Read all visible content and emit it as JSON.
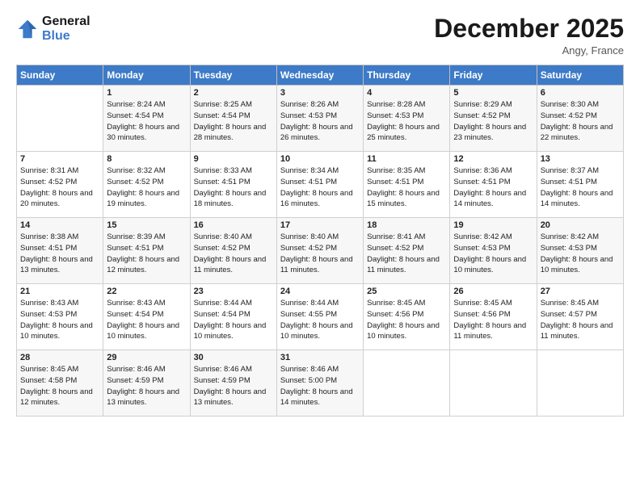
{
  "header": {
    "logo_line1": "General",
    "logo_line2": "Blue",
    "month": "December 2025",
    "location": "Angy, France"
  },
  "days_of_week": [
    "Sunday",
    "Monday",
    "Tuesday",
    "Wednesday",
    "Thursday",
    "Friday",
    "Saturday"
  ],
  "weeks": [
    [
      {
        "day": "",
        "sunrise": "",
        "sunset": "",
        "daylight": ""
      },
      {
        "day": "1",
        "sunrise": "Sunrise: 8:24 AM",
        "sunset": "Sunset: 4:54 PM",
        "daylight": "Daylight: 8 hours and 30 minutes."
      },
      {
        "day": "2",
        "sunrise": "Sunrise: 8:25 AM",
        "sunset": "Sunset: 4:54 PM",
        "daylight": "Daylight: 8 hours and 28 minutes."
      },
      {
        "day": "3",
        "sunrise": "Sunrise: 8:26 AM",
        "sunset": "Sunset: 4:53 PM",
        "daylight": "Daylight: 8 hours and 26 minutes."
      },
      {
        "day": "4",
        "sunrise": "Sunrise: 8:28 AM",
        "sunset": "Sunset: 4:53 PM",
        "daylight": "Daylight: 8 hours and 25 minutes."
      },
      {
        "day": "5",
        "sunrise": "Sunrise: 8:29 AM",
        "sunset": "Sunset: 4:52 PM",
        "daylight": "Daylight: 8 hours and 23 minutes."
      },
      {
        "day": "6",
        "sunrise": "Sunrise: 8:30 AM",
        "sunset": "Sunset: 4:52 PM",
        "daylight": "Daylight: 8 hours and 22 minutes."
      }
    ],
    [
      {
        "day": "7",
        "sunrise": "Sunrise: 8:31 AM",
        "sunset": "Sunset: 4:52 PM",
        "daylight": "Daylight: 8 hours and 20 minutes."
      },
      {
        "day": "8",
        "sunrise": "Sunrise: 8:32 AM",
        "sunset": "Sunset: 4:52 PM",
        "daylight": "Daylight: 8 hours and 19 minutes."
      },
      {
        "day": "9",
        "sunrise": "Sunrise: 8:33 AM",
        "sunset": "Sunset: 4:51 PM",
        "daylight": "Daylight: 8 hours and 18 minutes."
      },
      {
        "day": "10",
        "sunrise": "Sunrise: 8:34 AM",
        "sunset": "Sunset: 4:51 PM",
        "daylight": "Daylight: 8 hours and 16 minutes."
      },
      {
        "day": "11",
        "sunrise": "Sunrise: 8:35 AM",
        "sunset": "Sunset: 4:51 PM",
        "daylight": "Daylight: 8 hours and 15 minutes."
      },
      {
        "day": "12",
        "sunrise": "Sunrise: 8:36 AM",
        "sunset": "Sunset: 4:51 PM",
        "daylight": "Daylight: 8 hours and 14 minutes."
      },
      {
        "day": "13",
        "sunrise": "Sunrise: 8:37 AM",
        "sunset": "Sunset: 4:51 PM",
        "daylight": "Daylight: 8 hours and 14 minutes."
      }
    ],
    [
      {
        "day": "14",
        "sunrise": "Sunrise: 8:38 AM",
        "sunset": "Sunset: 4:51 PM",
        "daylight": "Daylight: 8 hours and 13 minutes."
      },
      {
        "day": "15",
        "sunrise": "Sunrise: 8:39 AM",
        "sunset": "Sunset: 4:51 PM",
        "daylight": "Daylight: 8 hours and 12 minutes."
      },
      {
        "day": "16",
        "sunrise": "Sunrise: 8:40 AM",
        "sunset": "Sunset: 4:52 PM",
        "daylight": "Daylight: 8 hours and 11 minutes."
      },
      {
        "day": "17",
        "sunrise": "Sunrise: 8:40 AM",
        "sunset": "Sunset: 4:52 PM",
        "daylight": "Daylight: 8 hours and 11 minutes."
      },
      {
        "day": "18",
        "sunrise": "Sunrise: 8:41 AM",
        "sunset": "Sunset: 4:52 PM",
        "daylight": "Daylight: 8 hours and 11 minutes."
      },
      {
        "day": "19",
        "sunrise": "Sunrise: 8:42 AM",
        "sunset": "Sunset: 4:53 PM",
        "daylight": "Daylight: 8 hours and 10 minutes."
      },
      {
        "day": "20",
        "sunrise": "Sunrise: 8:42 AM",
        "sunset": "Sunset: 4:53 PM",
        "daylight": "Daylight: 8 hours and 10 minutes."
      }
    ],
    [
      {
        "day": "21",
        "sunrise": "Sunrise: 8:43 AM",
        "sunset": "Sunset: 4:53 PM",
        "daylight": "Daylight: 8 hours and 10 minutes."
      },
      {
        "day": "22",
        "sunrise": "Sunrise: 8:43 AM",
        "sunset": "Sunset: 4:54 PM",
        "daylight": "Daylight: 8 hours and 10 minutes."
      },
      {
        "day": "23",
        "sunrise": "Sunrise: 8:44 AM",
        "sunset": "Sunset: 4:54 PM",
        "daylight": "Daylight: 8 hours and 10 minutes."
      },
      {
        "day": "24",
        "sunrise": "Sunrise: 8:44 AM",
        "sunset": "Sunset: 4:55 PM",
        "daylight": "Daylight: 8 hours and 10 minutes."
      },
      {
        "day": "25",
        "sunrise": "Sunrise: 8:45 AM",
        "sunset": "Sunset: 4:56 PM",
        "daylight": "Daylight: 8 hours and 10 minutes."
      },
      {
        "day": "26",
        "sunrise": "Sunrise: 8:45 AM",
        "sunset": "Sunset: 4:56 PM",
        "daylight": "Daylight: 8 hours and 11 minutes."
      },
      {
        "day": "27",
        "sunrise": "Sunrise: 8:45 AM",
        "sunset": "Sunset: 4:57 PM",
        "daylight": "Daylight: 8 hours and 11 minutes."
      }
    ],
    [
      {
        "day": "28",
        "sunrise": "Sunrise: 8:45 AM",
        "sunset": "Sunset: 4:58 PM",
        "daylight": "Daylight: 8 hours and 12 minutes."
      },
      {
        "day": "29",
        "sunrise": "Sunrise: 8:46 AM",
        "sunset": "Sunset: 4:59 PM",
        "daylight": "Daylight: 8 hours and 13 minutes."
      },
      {
        "day": "30",
        "sunrise": "Sunrise: 8:46 AM",
        "sunset": "Sunset: 4:59 PM",
        "daylight": "Daylight: 8 hours and 13 minutes."
      },
      {
        "day": "31",
        "sunrise": "Sunrise: 8:46 AM",
        "sunset": "Sunset: 5:00 PM",
        "daylight": "Daylight: 8 hours and 14 minutes."
      },
      {
        "day": "",
        "sunrise": "",
        "sunset": "",
        "daylight": ""
      },
      {
        "day": "",
        "sunrise": "",
        "sunset": "",
        "daylight": ""
      },
      {
        "day": "",
        "sunrise": "",
        "sunset": "",
        "daylight": ""
      }
    ]
  ]
}
